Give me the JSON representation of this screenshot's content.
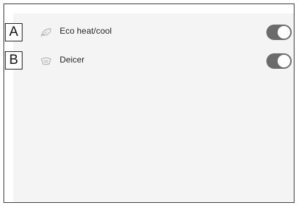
{
  "settings": {
    "items": [
      {
        "callout": "A",
        "icon": "leaf-icon",
        "label": "Eco heat/cool",
        "enabled": true
      },
      {
        "callout": "B",
        "icon": "deicer-icon",
        "label": "Deicer",
        "enabled": true
      }
    ]
  },
  "colors": {
    "toggle_on": "#6b6b6b",
    "screen_bg": "#f4f4f4"
  }
}
